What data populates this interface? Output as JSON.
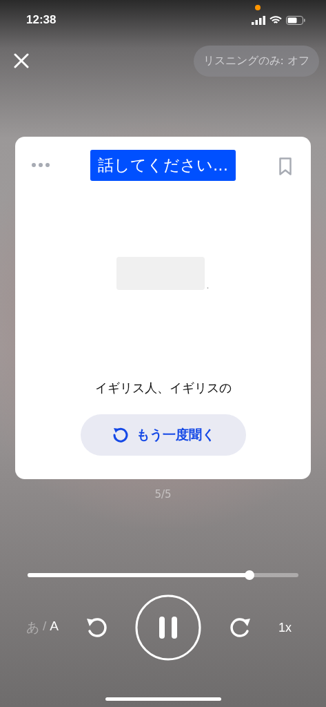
{
  "status_bar": {
    "time": "12:38",
    "recording_dot": true
  },
  "top_bar": {
    "listening_only": "リスニングのみ: オフ"
  },
  "card": {
    "prompt": "話してください...",
    "sentence_end": ".",
    "hint": "イギリス人、イギリスの",
    "replay_button": "もう一度聞く"
  },
  "counter": "5/5",
  "player": {
    "progress": {
      "level": 0.82
    },
    "script_toggle": [
      {
        "label": "あ",
        "selected": false
      },
      {
        "label": "A",
        "selected": true
      }
    ],
    "separator": "/",
    "playing": true,
    "speed": "1x"
  }
}
